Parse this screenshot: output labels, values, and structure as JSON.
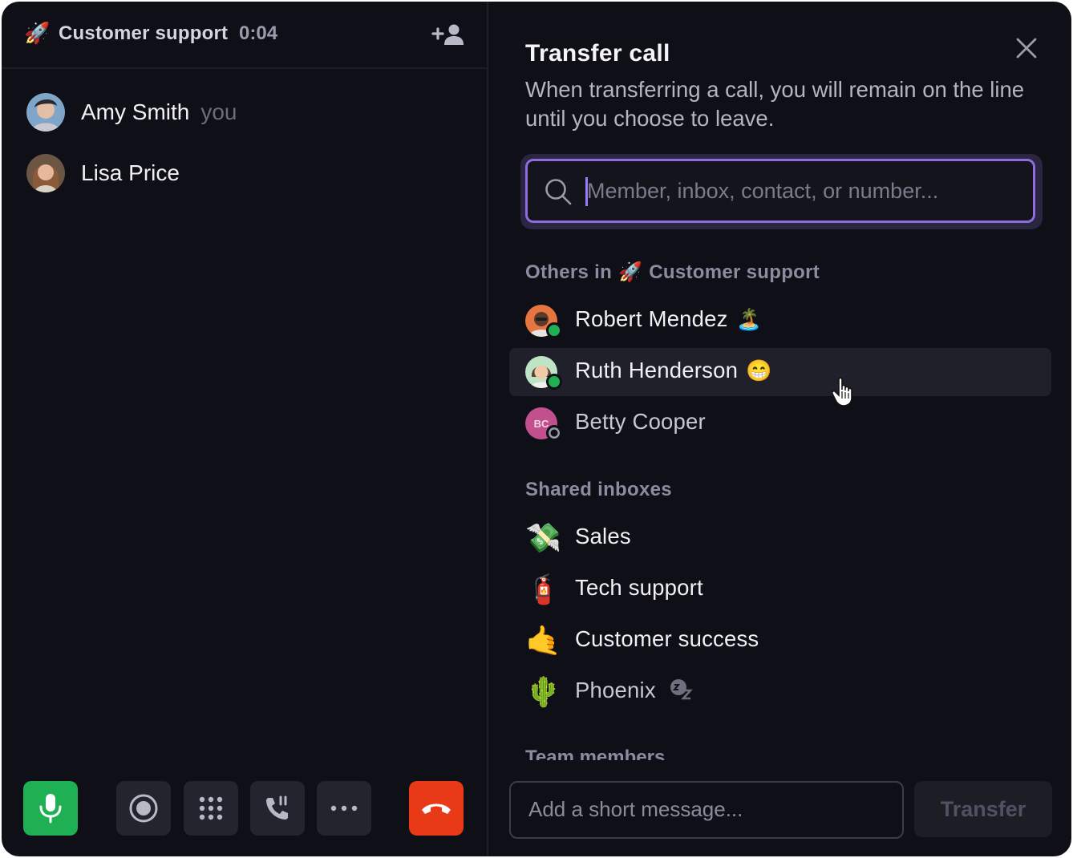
{
  "call": {
    "channel_emoji": "🚀",
    "channel_name": "Customer support",
    "timer": "0:04"
  },
  "participants": [
    {
      "name": "Amy Smith",
      "tag": "you"
    },
    {
      "name": "Lisa Price",
      "tag": ""
    }
  ],
  "transfer": {
    "title": "Transfer call",
    "description": "When transferring a call, you will remain on the line until you choose to leave.",
    "search_placeholder": "Member, inbox, contact, or number...",
    "section_others_prefix": "Others in",
    "section_others_emoji": "🚀",
    "section_others_team": "Customer support",
    "others": [
      {
        "name": "Robert Mendez",
        "status_emoji": "🏝️",
        "presence": "online"
      },
      {
        "name": "Ruth Henderson",
        "status_emoji": "😁",
        "presence": "online"
      },
      {
        "name": "Betty Cooper",
        "initials": "BC",
        "status_emoji": "",
        "presence": "offline"
      }
    ],
    "section_inboxes": "Shared inboxes",
    "inboxes": [
      {
        "emoji": "💸",
        "name": "Sales"
      },
      {
        "emoji": "🧯",
        "name": "Tech support"
      },
      {
        "emoji": "🤙",
        "name": "Customer success"
      },
      {
        "emoji": "🌵",
        "name": "Phoenix",
        "badge": "snooze-icon"
      }
    ],
    "section_team": "Team members",
    "message_placeholder": "Add a short message...",
    "transfer_label": "Transfer"
  },
  "colors": {
    "background": "#0f1017",
    "mic_green": "#1fb054",
    "hangup_red": "#e93a17",
    "focus_purple": "#8d6cdc",
    "online_green": "#1fb054"
  }
}
